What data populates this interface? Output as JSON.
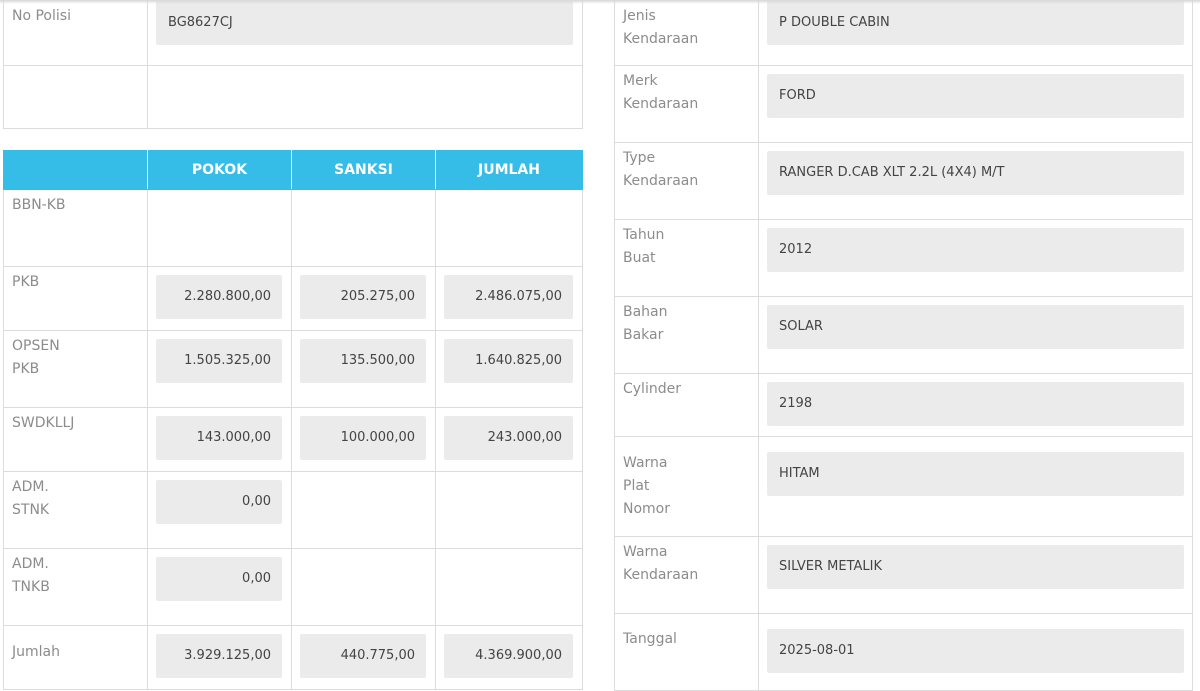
{
  "top_form": {
    "rows": [
      {
        "label": "No Polisi",
        "value": "BG8627CJ"
      },
      {
        "label": "",
        "value": ""
      }
    ]
  },
  "tax_table": {
    "headers": [
      "",
      "POKOK",
      "SANKSI",
      "JUMLAH"
    ],
    "rows": [
      {
        "label": "BBN-KB",
        "pokok": "",
        "sanksi": "",
        "jumlah": ""
      },
      {
        "label": "PKB",
        "pokok": "2.280.800,00",
        "sanksi": "205.275,00",
        "jumlah": "2.486.075,00"
      },
      {
        "label": "OPSEN PKB",
        "pokok": "1.505.325,00",
        "sanksi": "135.500,00",
        "jumlah": "1.640.825,00"
      },
      {
        "label": "SWDKLLJ",
        "pokok": "143.000,00",
        "sanksi": "100.000,00",
        "jumlah": "243.000,00"
      },
      {
        "label": "ADM. STNK",
        "pokok": "0,00",
        "sanksi": "",
        "jumlah": ""
      },
      {
        "label": "ADM. TNKB",
        "pokok": "0,00",
        "sanksi": "",
        "jumlah": ""
      },
      {
        "label": "Jumlah",
        "pokok": "3.929.125,00",
        "sanksi": "440.775,00",
        "jumlah": "4.369.900,00"
      }
    ]
  },
  "vehicle": {
    "rows": [
      {
        "label": "Jenis Kendaraan",
        "value": "P DOUBLE CABIN"
      },
      {
        "label": "Merk Kendaraan",
        "value": "FORD"
      },
      {
        "label": "Type Kendaraan",
        "value": "RANGER D.CAB XLT 2.2L (4X4) M/T"
      },
      {
        "label": "Tahun Buat",
        "value": "2012"
      },
      {
        "label": "Bahan Bakar",
        "value": "SOLAR"
      },
      {
        "label": "Cylinder",
        "value": "2198"
      },
      {
        "label": "Warna Plat Nomor",
        "value": "HITAM"
      },
      {
        "label": "Warna Kendaraan",
        "value": "SILVER METALIK"
      },
      {
        "label": "Tanggal",
        "value": "2025-08-01"
      }
    ]
  },
  "colors": {
    "header_bg": "#35bde8",
    "field_bg": "#ebebeb",
    "border": "#dcdcdc"
  }
}
